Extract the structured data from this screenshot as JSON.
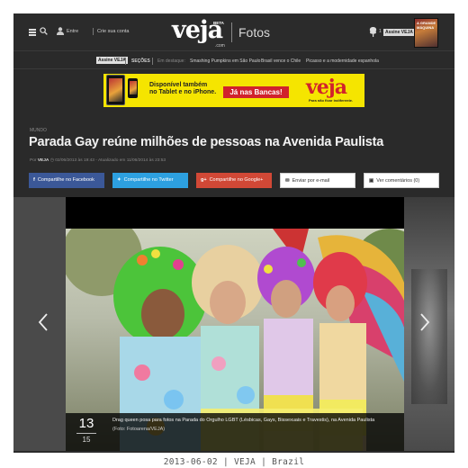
{
  "header": {
    "menu_icon": "hamburger-icon",
    "search_icon": "search-icon",
    "login_label": "Entre",
    "signup_label": "Crie sua conta",
    "logo_text": "veja",
    "logo_beta": "BETA",
    "logo_com": ".com",
    "section_label": "Fotos",
    "count": "1",
    "subscribe_label": "Assine VEJA",
    "magazine_label": "A GRANDE MÁQUINA"
  },
  "subnav": {
    "subscribe_label": "Assine VEJA",
    "sections_label": "SEÇÕES",
    "highlight_label": "Em destaque:",
    "links": [
      "Smashing Pumpkins em São Paulo",
      "Brasil vence o Chile",
      "Picasso e a modernidade espanhola"
    ]
  },
  "ad": {
    "line1": "Disponível também",
    "line2": "no Tablet e no iPhone.",
    "button": "Já nas Bancas!",
    "logo": "veja",
    "tagline": "Para não ficar indiferente."
  },
  "article": {
    "kicker": "MUNDO",
    "title": "Parada Gay reúne milhões de pessoas na Avenida Paulista",
    "byline_prefix": "Por",
    "byline_author": "VEJA",
    "byline_rest": "02/06/2013 às 19:43 - Atualizado em 11/06/2014 às 23:53"
  },
  "share": {
    "facebook": "Compartilhe no Facebook",
    "twitter": "Compartilhe no Twitter",
    "google": "Compartilhe no Google+",
    "email": "Enviar por e-mail",
    "comments": "Ver comentários (0)"
  },
  "gallery": {
    "current": "13",
    "total": "15",
    "caption": "Drag queen posa para fotos na Parada do Orgulho LGBT (Lésbicas, Gays, Bissexuais e Travestis), na Avenida Paulista",
    "credit": "(Foto: Fotoarena/VEJA)"
  },
  "footer": "2013-06-02 | VEJA | Brazil",
  "colors": {
    "page_bg": "#2a2a2a",
    "facebook": "#3b5898",
    "twitter": "#2da0e0",
    "google": "#d14836",
    "ad_yellow": "#f5e500",
    "veja_red": "#d1222c"
  }
}
